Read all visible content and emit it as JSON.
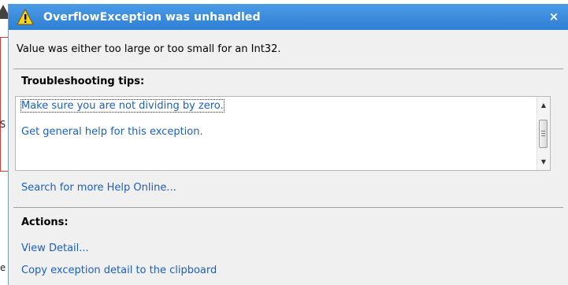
{
  "dialog": {
    "title": "OverflowException was unhandled",
    "close_symbol": "×",
    "message": "Value was either too large or too small for an Int32.",
    "title_color": "#2f7fd4"
  },
  "troubleshooting": {
    "heading": "Troubleshooting tips:",
    "tips": [
      {
        "label": "Make sure you are not dividing by zero."
      },
      {
        "label": "Get general help for this exception."
      }
    ],
    "scroll_up_symbol": "▲",
    "scroll_down_symbol": "▼"
  },
  "search_link": "Search for more Help Online...",
  "actions": {
    "heading": "Actions:",
    "items": [
      {
        "label": "View Detail..."
      },
      {
        "label": "Copy exception detail to the clipboard"
      }
    ]
  },
  "background": {
    "editor_chars": [
      "S",
      "e"
    ]
  },
  "colors": {
    "link": "#1a5fc2",
    "panel_bg": "#f0f0f0",
    "warning": "#f7d31e"
  },
  "icons": {
    "title_icon": "warning-triangle-icon",
    "close": "close-icon"
  }
}
